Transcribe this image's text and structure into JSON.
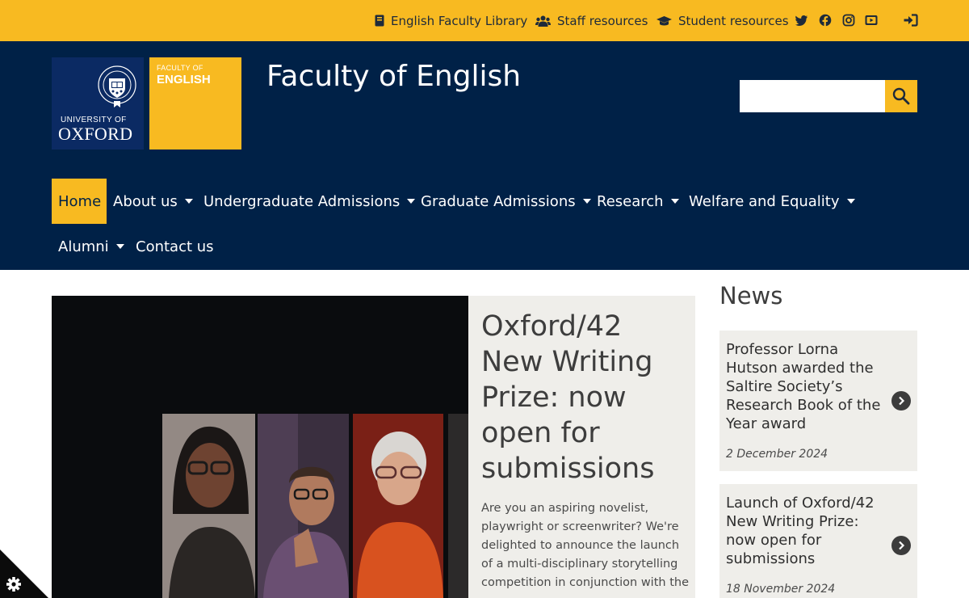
{
  "topbar": {
    "links": [
      {
        "label": "English Faculty Library",
        "icon": "book-icon"
      },
      {
        "label": "Staff resources",
        "icon": "users-icon"
      },
      {
        "label": "Student resources",
        "icon": "graduation-cap-icon"
      }
    ],
    "social_icons": [
      "twitter-icon",
      "facebook-icon",
      "instagram-icon",
      "youtube-icon"
    ],
    "login_icon": "sign-in-icon"
  },
  "header": {
    "oxford_logo": {
      "line1": "UNIVERSITY OF",
      "line2": "OXFORD"
    },
    "faculty_logo": {
      "line1": "FACULTY OF",
      "line2": "ENGLISH"
    },
    "site_title": "Faculty of English",
    "search": {
      "placeholder": "",
      "value": ""
    }
  },
  "nav": {
    "items": [
      {
        "label": "Home",
        "active": true,
        "dropdown": false
      },
      {
        "label": "About us",
        "dropdown": true
      },
      {
        "label": "Undergraduate Admissions",
        "dropdown": true
      },
      {
        "label": "Graduate Admissions",
        "dropdown": true
      },
      {
        "label": "Research",
        "dropdown": true
      },
      {
        "label": "Welfare and Equality",
        "dropdown": true
      },
      {
        "label": "Alumni",
        "dropdown": true
      },
      {
        "label": "Contact us",
        "dropdown": false
      }
    ]
  },
  "feature": {
    "title": "Oxford/42 New Writing Prize: now open for submissions",
    "text": "Are you an aspiring novelist, playwright or screenwriter? We're delighted to announce the launch of a multi-disciplinary storytelling competition in conjunction with the"
  },
  "news": {
    "heading": "News",
    "items": [
      {
        "title": "Professor Lorna Hutson awarded the Saltire Society’s Research Book of the Year award",
        "date": "2 December 2024"
      },
      {
        "title": "Launch of Oxford/42 New Writing Prize: now open for submissions",
        "date": "18 November 2024"
      }
    ]
  },
  "colors": {
    "brand_navy": "#002147",
    "brand_yellow": "#f8ba21",
    "panel_grey": "#efeeea"
  },
  "cookie_icon": "gear-icon"
}
